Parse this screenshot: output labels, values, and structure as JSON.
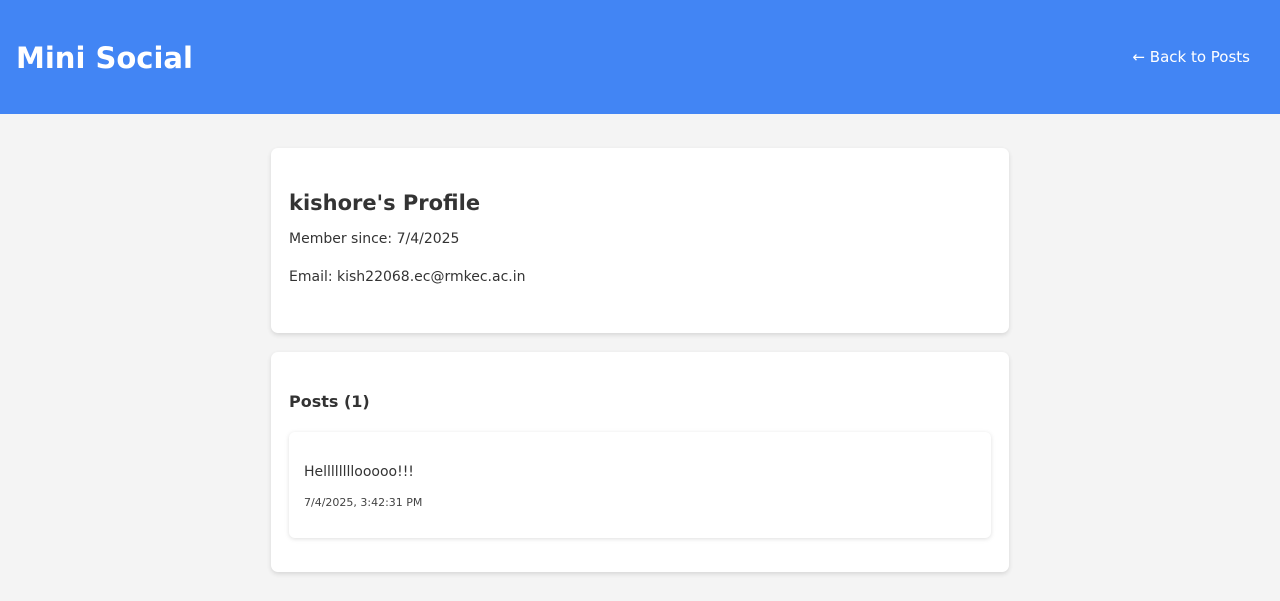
{
  "header": {
    "app_title": "Mini Social",
    "back_link_label": "← Back to Posts"
  },
  "profile": {
    "title": "kishore's Profile",
    "member_since": "Member since: 7/4/2025",
    "email": "Email: kish22068.ec@rmkec.ac.in"
  },
  "posts": {
    "heading": "Posts (1)",
    "items": [
      {
        "content": "Hellllllllooooo!!!",
        "timestamp": "7/4/2025, 3:42:31 PM"
      }
    ]
  },
  "colors": {
    "header_bg": "#4285f4",
    "page_bg": "#f4f4f4",
    "card_bg": "#ffffff",
    "text": "#333333"
  }
}
